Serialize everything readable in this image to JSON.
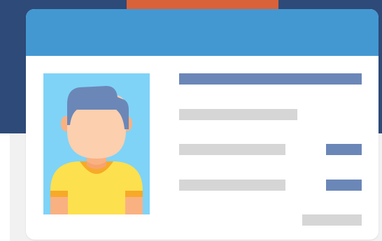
{
  "colors": {
    "background_dark": "#2e4a78",
    "background_light": "#f1f1f1",
    "lanyard_tab": "#d9623a",
    "card": "#ffffff",
    "card_header": "#4398d2",
    "photo_background": "#7fd3f7",
    "accent_bar": "#6b87b8",
    "placeholder_bar": "#d6d6d6"
  },
  "card": {
    "photo_icon": "user-avatar-icon",
    "text_lines": [
      {
        "role": "name",
        "style": "accent"
      },
      {
        "role": "field-1",
        "style": "placeholder"
      },
      {
        "role": "field-2",
        "style": "placeholder"
      },
      {
        "role": "field-2-value",
        "style": "accent"
      },
      {
        "role": "field-3",
        "style": "placeholder"
      },
      {
        "role": "field-3-value",
        "style": "accent"
      },
      {
        "role": "signature",
        "style": "placeholder"
      }
    ]
  }
}
